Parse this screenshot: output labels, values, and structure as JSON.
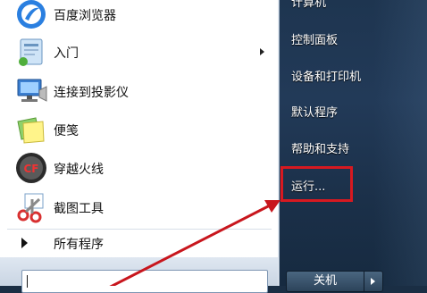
{
  "programs": [
    {
      "label": "百度浏览器",
      "icon": "baidu-browser-icon"
    },
    {
      "label": "入门",
      "icon": "getting-started-icon",
      "has_submenu": true
    },
    {
      "label": "连接到投影仪",
      "icon": "projector-icon"
    },
    {
      "label": "便笺",
      "icon": "sticky-notes-icon"
    },
    {
      "label": "穿越火线",
      "icon": "crossfire-game-icon"
    },
    {
      "label": "截图工具",
      "icon": "snipping-tool-icon"
    }
  ],
  "all_programs": {
    "label": "所有程序"
  },
  "right_items": [
    {
      "label": "计算机"
    },
    {
      "label": "控制面板"
    },
    {
      "label": "设备和打印机"
    },
    {
      "label": "默认程序"
    },
    {
      "label": "帮助和支持"
    },
    {
      "label": "运行..."
    }
  ],
  "shutdown": {
    "label": "关机"
  },
  "colors": {
    "highlight_box": "#d71920",
    "annotation_arrow": "#c8161d",
    "right_pane": "#1e3550"
  }
}
